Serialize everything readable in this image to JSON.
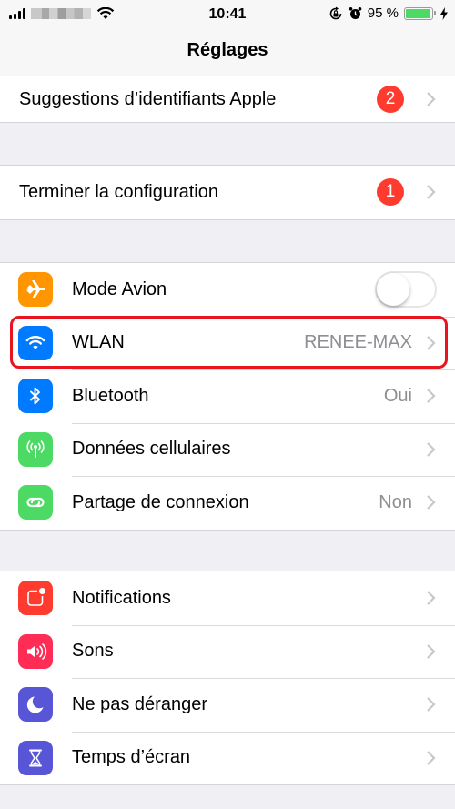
{
  "status_bar": {
    "time": "10:41",
    "battery_percent_text": "95 %",
    "battery_level": 0.95,
    "icons": [
      "signal-icon",
      "wifi-icon",
      "rotation-lock-icon",
      "alarm-icon",
      "battery-icon",
      "charging-icon"
    ]
  },
  "nav": {
    "title": "Réglages"
  },
  "groups": [
    {
      "rows": [
        {
          "label": "Suggestions d’identifiants Apple",
          "badge": "2"
        }
      ]
    },
    {
      "rows": [
        {
          "label": "Terminer la configuration",
          "badge": "1"
        }
      ]
    },
    {
      "rows": [
        {
          "label": "Mode Avion",
          "icon": "airplane-icon",
          "icon_color": "#ff9500",
          "toggle_on": false
        },
        {
          "label": "WLAN",
          "icon": "wifi-icon",
          "icon_color": "#007aff",
          "value": "RENEE-MAX",
          "highlighted": true
        },
        {
          "label": "Bluetooth",
          "icon": "bluetooth-icon",
          "icon_color": "#007aff",
          "value": "Oui"
        },
        {
          "label": "Données cellulaires",
          "icon": "antenna-icon",
          "icon_color": "#4cd964",
          "value": ""
        },
        {
          "label": "Partage de connexion",
          "icon": "hotspot-link-icon",
          "icon_color": "#4cd964",
          "value": "Non"
        }
      ]
    },
    {
      "rows": [
        {
          "label": "Notifications",
          "icon": "notifications-icon",
          "icon_color": "#ff3b30"
        },
        {
          "label": "Sons",
          "icon": "speaker-icon",
          "icon_color": "#ff2d55"
        },
        {
          "label": "Ne pas déranger",
          "icon": "moon-icon",
          "icon_color": "#5856d6"
        },
        {
          "label": "Temps d’écran",
          "icon": "hourglass-icon",
          "icon_color": "#5856d6"
        }
      ]
    }
  ],
  "highlight_color": "#e8141e"
}
